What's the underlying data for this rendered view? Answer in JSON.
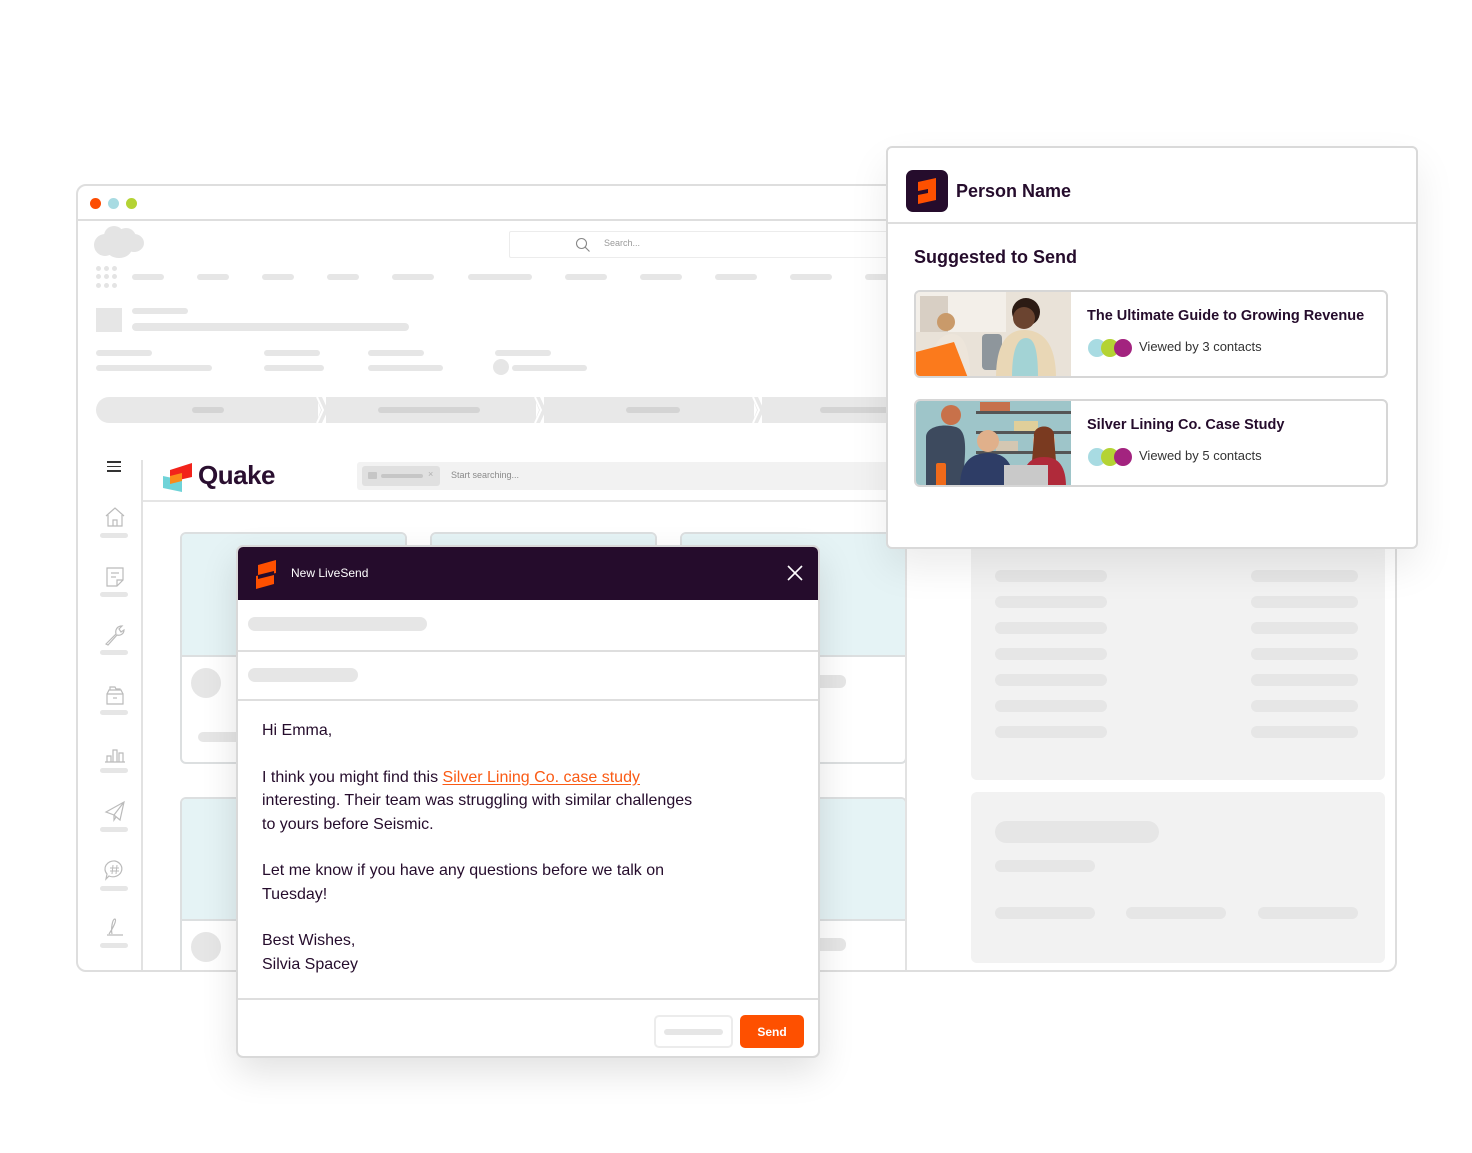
{
  "browser": {
    "traffic_lights": [
      {
        "name": "close",
        "color": "#fc4c02"
      },
      {
        "name": "minimize",
        "color": "#a8dbe2"
      },
      {
        "name": "maximize",
        "color": "#b4d334"
      }
    ],
    "search_placeholder": "Search...",
    "logo_icon": "cloud-icon",
    "apps_icon": "app-launcher-icon"
  },
  "quake": {
    "brand_name": "Quake",
    "search_placeholder": "Start searching...",
    "filter_chip_close": "×",
    "rail_icons": [
      "home-icon",
      "note-icon",
      "wrench-icon",
      "file-drawer-icon",
      "bar-chart-icon",
      "paper-plane-icon",
      "chat-hashtag-icon",
      "signature-icon"
    ]
  },
  "person_panel": {
    "name": "Person Name",
    "section_title": "Suggested to Send",
    "assets": [
      {
        "title": "The Ultimate Guide to Growing Revenue",
        "views": "Viewed by 3 contacts",
        "viewer_colors": [
          "#a8dbe2",
          "#b4d334",
          "#a3237f"
        ]
      },
      {
        "title": "Silver Lining Co. Case Study",
        "views": "Viewed by 5 contacts",
        "viewer_colors": [
          "#a8dbe2",
          "#b4d334",
          "#a3237f"
        ]
      }
    ]
  },
  "livesend": {
    "title": "New LiveSend",
    "greeting": "Hi Emma,",
    "para1_before": "I think you might find this ",
    "para1_link": "Silver Lining Co. case study",
    "para1_after": " interesting. Their team was struggling with similar challenges to yours before Seismic.",
    "para2": "Let me know if you have any questions before we talk on Tuesday!",
    "signoff": "Best Wishes,",
    "signature": "Silvia Spacey",
    "send_label": "Send"
  },
  "colors": {
    "brand_dark": "#250c2c",
    "accent_orange": "#fe5000",
    "link_orange": "#fa5a14",
    "card_tint": "#e5f3f5"
  }
}
